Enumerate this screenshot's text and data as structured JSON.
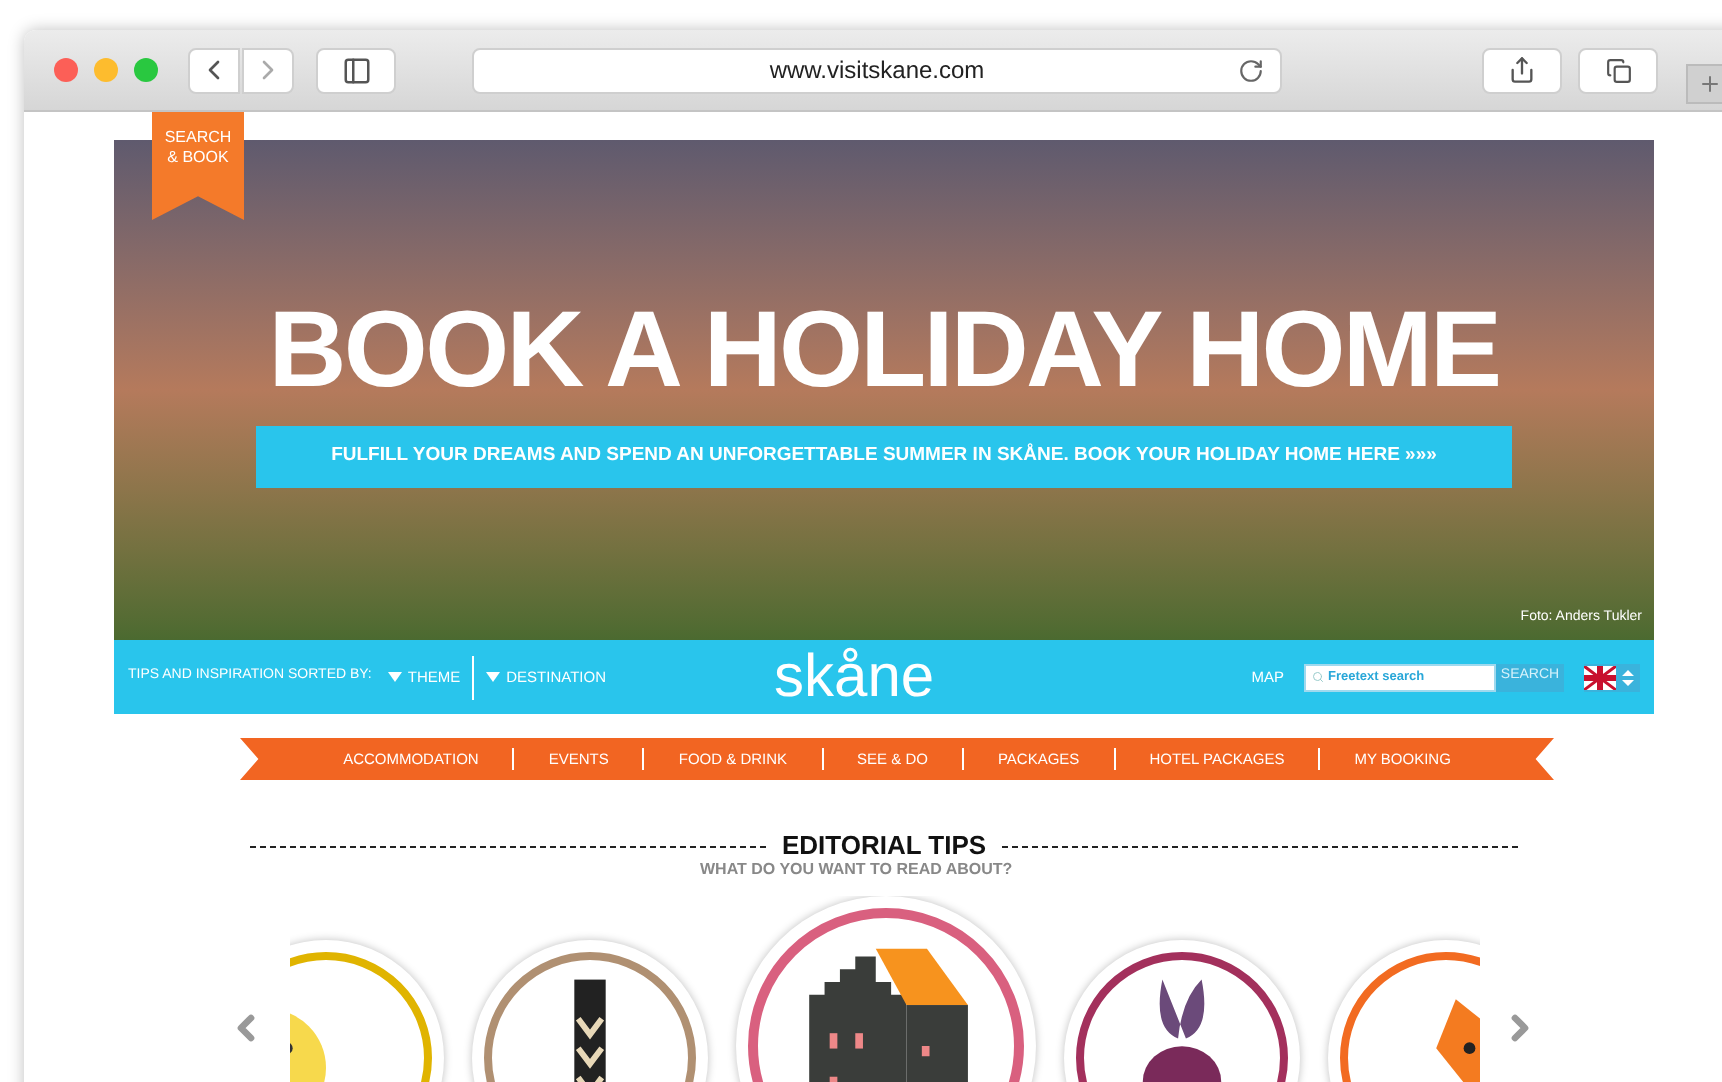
{
  "browser": {
    "url": "www.visitskane.com"
  },
  "ribbon": {
    "label": "SEARCH & BOOK"
  },
  "hero": {
    "title": "BOOK A HOLIDAY HOME",
    "banner": "FULFILL YOUR DREAMS AND SPEND AN UNFORGETTABLE SUMMER IN SKÅNE. BOOK YOUR HOLIDAY HOME HERE »»»",
    "credit": "Foto: Anders Tukler"
  },
  "filter_bar": {
    "label": "TIPS AND INSPIRATION SORTED BY:",
    "filters": [
      "THEME",
      "DESTINATION"
    ],
    "logo": "skåne",
    "map_link": "MAP",
    "search": {
      "placeholder": "Freetext search",
      "button": "SEARCH"
    }
  },
  "nav": [
    "ACCOMMODATION",
    "EVENTS",
    "FOOD & DRINK",
    "SEE & DO",
    "PACKAGES",
    "HOTEL PACKAGES",
    "MY BOOKING"
  ],
  "section": {
    "title": "EDITORIAL TIPS",
    "subtitle": "WHAT DO YOU WANT TO READ ABOUT?"
  },
  "carousel": [
    {
      "color": "#e0b400",
      "selected": false
    },
    {
      "color": "#b09072",
      "selected": false
    },
    {
      "color": "#d9607f",
      "selected": true
    },
    {
      "color": "#a3305c",
      "selected": false
    },
    {
      "color": "#f26b21",
      "selected": false
    }
  ]
}
